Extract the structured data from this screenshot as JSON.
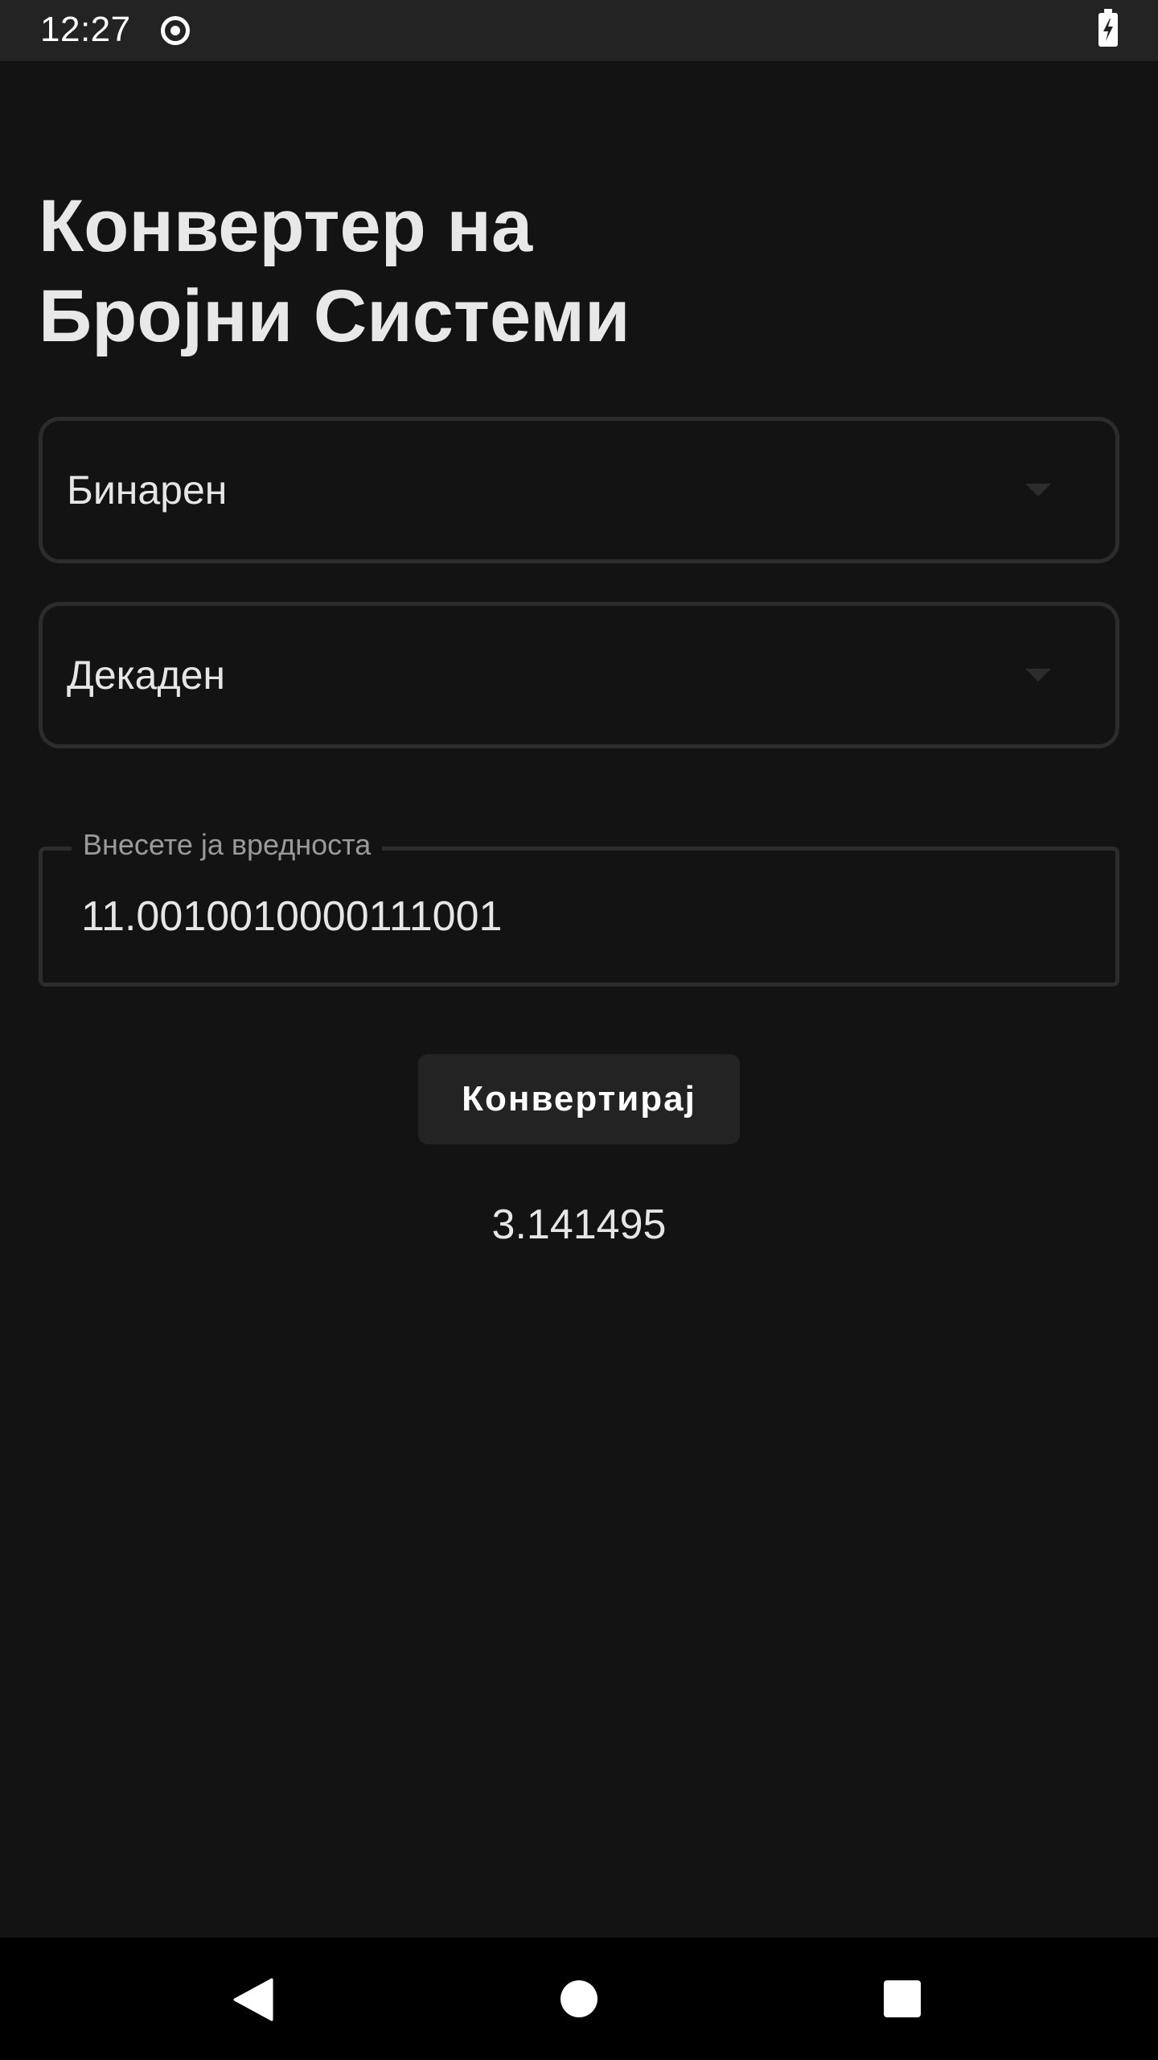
{
  "status_bar": {
    "time": "12:27",
    "icons": [
      "record-icon",
      "battery-charging-icon"
    ]
  },
  "title": {
    "line1": "Конвертер на",
    "line2": "Бројни Системи"
  },
  "from_system": {
    "selected": "Бинарен"
  },
  "to_system": {
    "selected": "Декаден"
  },
  "input": {
    "label": "Внесете ја вредноста",
    "value": "11.0010010000111001"
  },
  "convert_button": {
    "label": "Конвертирај"
  },
  "result": {
    "value": "3.141495"
  },
  "colors": {
    "background": "#131313",
    "status_bar": "#232323",
    "outline": "#2c2c2c",
    "button": "#232323",
    "nav_bar": "#000000"
  }
}
